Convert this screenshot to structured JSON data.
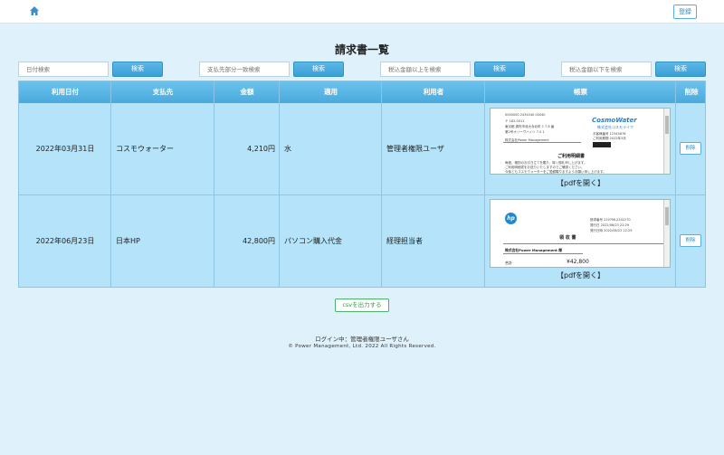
{
  "header": {
    "register_label": "登録",
    "home_icon": "home-icon"
  },
  "page": {
    "title": "請求書一覧"
  },
  "search": {
    "fields": [
      {
        "placeholder": "日付検索",
        "button": "検索"
      },
      {
        "placeholder": "支払先部分一致検索",
        "button": "検索"
      },
      {
        "placeholder": "税込金額以上を検索",
        "button": "検索"
      },
      {
        "placeholder": "税込金額以下を検索",
        "button": "検索"
      }
    ]
  },
  "table": {
    "headers": [
      "利用日付",
      "支払先",
      "金額",
      "適用",
      "利用者",
      "帳票",
      "削除"
    ],
    "rows": [
      {
        "date": "2022年03月31日",
        "payee": "コスモウォーター",
        "amount": "4,210円",
        "description": "水",
        "user": "管理者権限ユーザ",
        "pdf_label": "【pdfを開く】",
        "delete_label": "削除",
        "thumb": {
          "brand": "CosmoWater",
          "brand_sub": "株式会社コスモライフ",
          "heading": "ご利用明細書"
        }
      },
      {
        "date": "2022年06月23日",
        "payee": "日本HP",
        "amount": "42,800円",
        "description": "パソコン購入代金",
        "user": "経理担当者",
        "pdf_label": "【pdfを開く】",
        "delete_label": "削除",
        "thumb": {
          "brand": "hp",
          "heading": "領 収 書",
          "company": "株式会社Power Management 様",
          "total_label": "合計",
          "total_value": "¥42,800"
        }
      }
    ]
  },
  "actions": {
    "csv_label": "csvを出力する"
  },
  "footer": {
    "login": "ログイン中：管理者権限ユーザさん",
    "copyright": "© Power Management, Ltd. 2022 All Rights Reserved."
  },
  "colors": {
    "header_blue": "#49a9dd",
    "row_bg": "#b4e3fa",
    "page_bg": "#dff1fb",
    "csv_green": "#3a9a55"
  }
}
